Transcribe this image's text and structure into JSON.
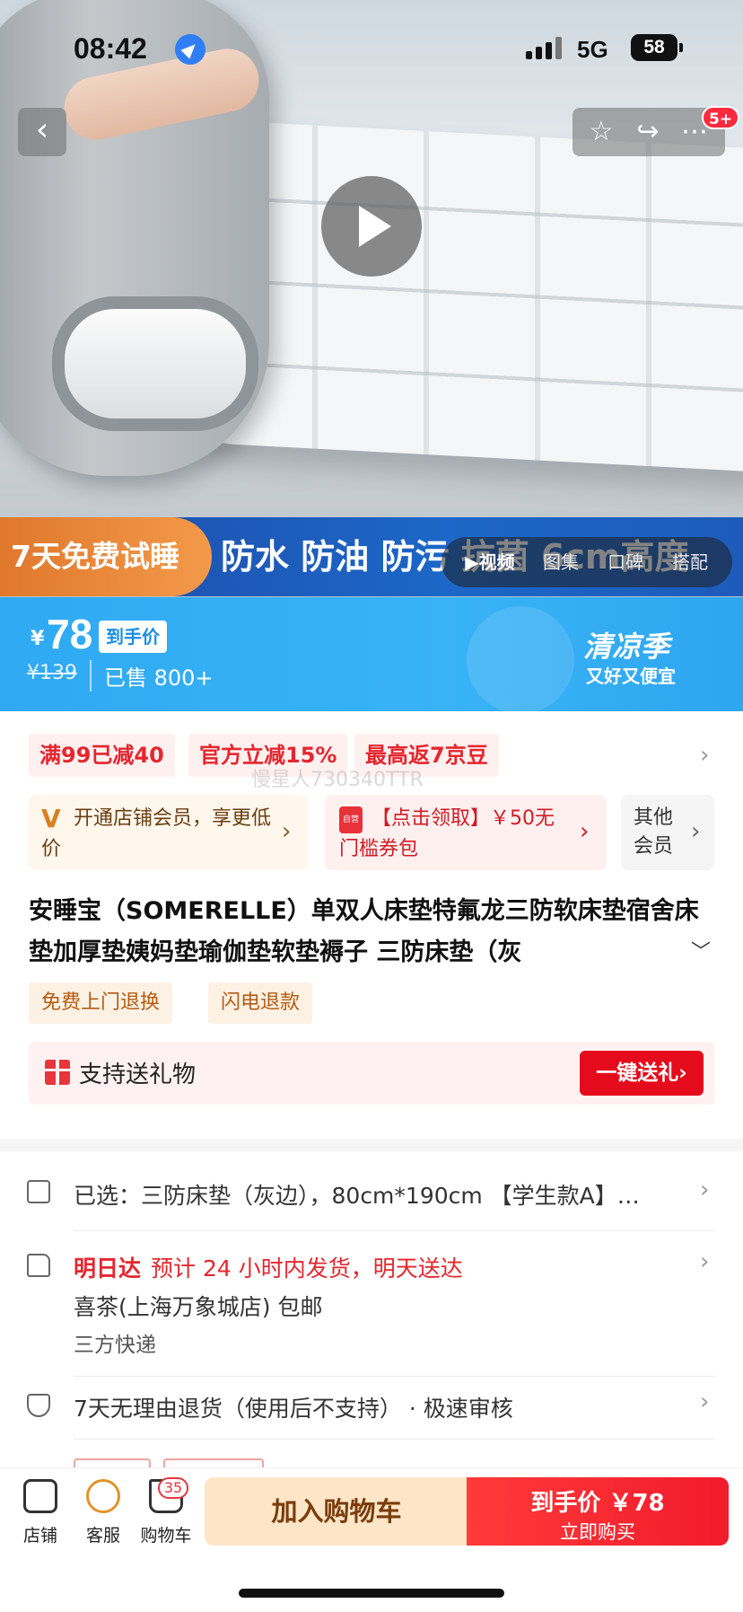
{
  "status_bar": {
    "time": "08:42",
    "network": "5G",
    "battery": "58"
  },
  "nav": {
    "back": "‹",
    "notification_badge": "5+"
  },
  "hero": {
    "banner_left": "7天免费试睡",
    "banner_text": "防水 防油 防污 抗菌 6cm高度",
    "media_tabs": [
      "▶视频",
      "图集",
      "口碑",
      "搭配"
    ]
  },
  "price": {
    "currency": "¥",
    "final_price": "78",
    "final_label": "到手价",
    "original_price": "¥139",
    "sold": "已售 800+",
    "promo_title": "清凉季",
    "promo_sub": "又好又便宜"
  },
  "coupons": [
    "满99已减40",
    "官方立减15%",
    "最高返7京豆"
  ],
  "watermark": "慢星人730340TTR",
  "cards": {
    "member": "开通店铺会员，享更低价",
    "coupon_pack": "【点击领取】￥50无门槛券包",
    "coupon_icon": "自营",
    "other": "其他会员"
  },
  "product_title": "安睡宝（SOMERELLE）单双人床垫特氟龙三防软床垫宿舍床垫加厚垫姨妈垫瑜伽垫软垫褥子 三防床垫（灰",
  "services": [
    "免费上门退换",
    "闪电退款"
  ],
  "gift": {
    "label": "支持送礼物",
    "button": "一键送礼›"
  },
  "rows": {
    "selected": "已选：三防床垫（灰边），80cm*190cm 【学生款A】…",
    "delivery_title": "明日达",
    "delivery_desc": "预计 24 小时内发货，明天送达",
    "store": "喜茶(上海万象城店)  包邮",
    "courier": "三方快递",
    "return_policy": "7天无理由退货（使用后不支持） · 极速审核"
  },
  "bottom_bar": {
    "shop": "店铺",
    "service": "客服",
    "cart": "购物车",
    "cart_count": "35",
    "add_to_cart": "加入购物车",
    "buy_line1": "到手价 ￥78",
    "buy_line2": "立即购买"
  }
}
